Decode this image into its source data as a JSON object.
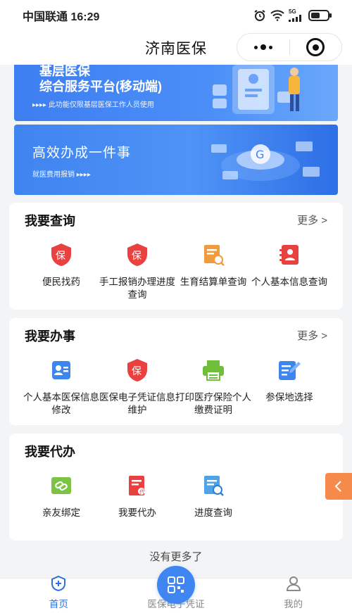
{
  "status_bar": {
    "carrier": "中国联通",
    "time": "16:29",
    "network": "5G"
  },
  "nav": {
    "title": "济南医保"
  },
  "banners": [
    {
      "title_line1": "基层医保",
      "title_line2": "综合服务平台(移动端)",
      "subtitle": "▸▸▸▸ 此功能仅限基层医保工作人员使用"
    },
    {
      "title": "高效办成一件事",
      "subtitle": "就医费用报销 ▸▸▸▸"
    }
  ],
  "sections": [
    {
      "title": "我要查询",
      "more": "更多 >",
      "items": [
        {
          "label": "便民找药",
          "icon": "shield-bao-icon"
        },
        {
          "label": "手工报销办理进度查询",
          "icon": "shield-bao-icon"
        },
        {
          "label": "生育结算单查询",
          "icon": "document-search-icon"
        },
        {
          "label": "个人基本信息查询",
          "icon": "contact-book-icon"
        }
      ]
    },
    {
      "title": "我要办事",
      "more": "更多 >",
      "items": [
        {
          "label": "个人基本医保信息修改",
          "icon": "id-card-icon"
        },
        {
          "label": "医保电子凭证信息维护",
          "icon": "shield-bao-icon"
        },
        {
          "label": "打印医疗保险个人缴费证明",
          "icon": "printer-icon"
        },
        {
          "label": "参保地选择",
          "icon": "edit-document-icon"
        }
      ]
    },
    {
      "title": "我要代办",
      "items": [
        {
          "label": "亲友绑定",
          "icon": "link-icon"
        },
        {
          "label": "我要代办",
          "icon": "document-icon"
        },
        {
          "label": "进度查询",
          "icon": "document-search-icon"
        }
      ]
    }
  ],
  "footer_note": "没有更多了",
  "tab_bar": [
    {
      "label": "首页",
      "icon": "home-shield-icon",
      "active": true
    },
    {
      "label": "医保电子凭证",
      "icon": "qr-code-icon",
      "active": false
    },
    {
      "label": "我的",
      "icon": "user-icon",
      "active": false
    }
  ],
  "colors": {
    "primary": "#2f6fe0",
    "red": "#e8413f",
    "orange": "#f58a4b",
    "green": "#6fbf3d",
    "blue_icon": "#3d86f0"
  }
}
